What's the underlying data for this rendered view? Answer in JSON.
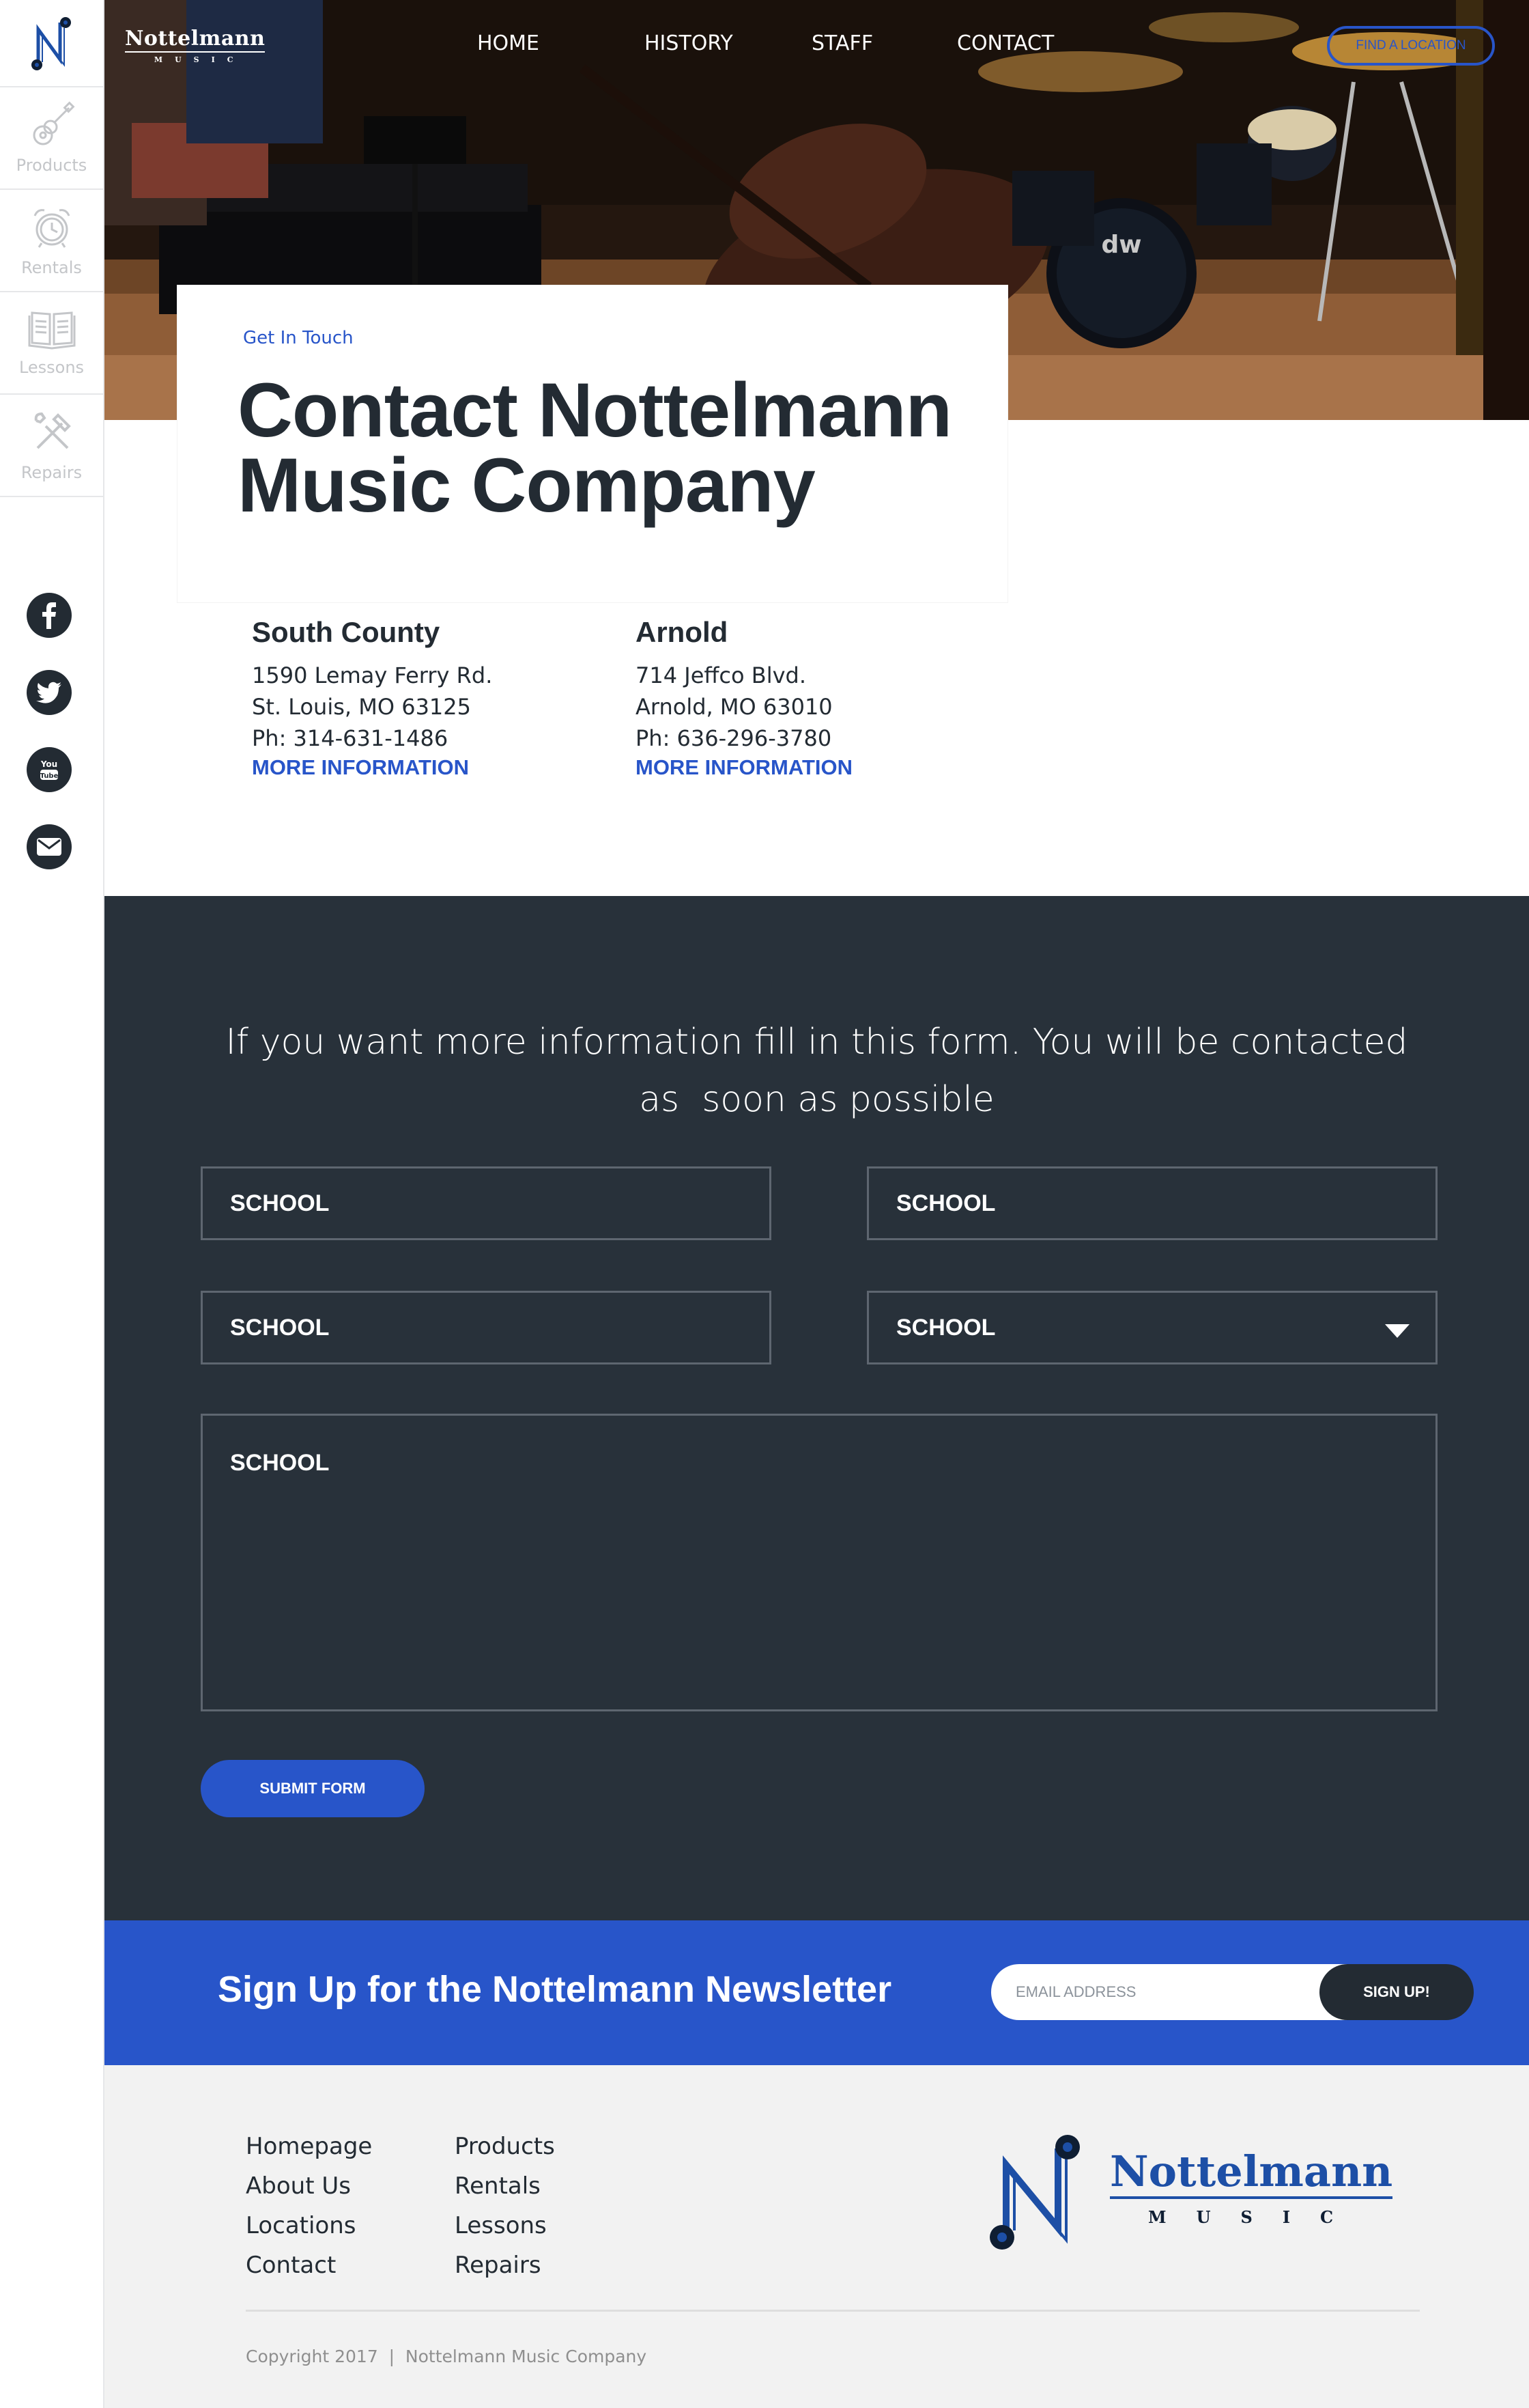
{
  "sidebar": {
    "items": [
      {
        "label": "Products",
        "icon": "guitar-icon"
      },
      {
        "label": "Rentals",
        "icon": "alarm-clock-icon"
      },
      {
        "label": "Lessons",
        "icon": "book-icon"
      },
      {
        "label": "Repairs",
        "icon": "wrench-hammer-icon"
      }
    ],
    "social": [
      "facebook-icon",
      "twitter-icon",
      "youtube-icon",
      "email-icon"
    ]
  },
  "brand": {
    "name": "Nottelmann",
    "sub": "MUSIC"
  },
  "nav": {
    "items": [
      "HOME",
      "HISTORY",
      "STAFF",
      "CONTACT"
    ],
    "find_location": "FIND A LOCATION"
  },
  "header": {
    "kicker": "Get In Touch",
    "title_line1": "Contact Nottelmann",
    "title_line2": "Music Company"
  },
  "locations": [
    {
      "name": "South County",
      "address1": "1590 Lemay Ferry Rd.",
      "address2": "St. Louis, MO 63125",
      "phone": "Ph: 314-631-1486",
      "more": "MORE INFORMATION"
    },
    {
      "name": "Arnold",
      "address1": "714 Jeffco Blvd.",
      "address2": "Arnold, MO 63010",
      "phone": "Ph: 636-296-3780",
      "more": "MORE INFORMATION"
    }
  ],
  "form": {
    "intro_line1": "If you want more information fill in this form. You will be contacted",
    "intro_line2": "as  soon as possible",
    "field1": "SCHOOL",
    "field2": "SCHOOL",
    "field3": "SCHOOL",
    "field4": "SCHOOL",
    "message": "SCHOOL",
    "submit": "SUBMIT FORM"
  },
  "newsletter": {
    "title": "Sign Up for the Nottelmann Newsletter",
    "email_placeholder": "EMAIL ADDRESS",
    "button": "SIGN UP!"
  },
  "footer": {
    "col1": [
      "Homepage",
      "About Us",
      "Locations",
      "Contact"
    ],
    "col2": [
      "Products",
      "Rentals",
      "Lessons",
      "Repairs"
    ],
    "logo_name": "Nottelmann",
    "logo_sub": "MUSIC",
    "copyright": "Copyright 2017  |  Nottelmann Music Company"
  },
  "colors": {
    "accent": "#2855c9",
    "dark": "#28313a",
    "text": "#232b33",
    "footer_bg": "#f2f2f2"
  }
}
